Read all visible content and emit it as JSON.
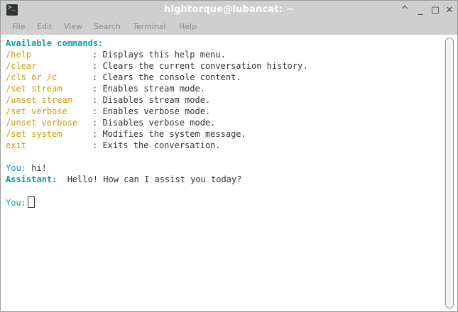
{
  "window": {
    "title": "hightorque@lubancat: ~",
    "icon": "terminal-icon",
    "controls": {
      "minimize": "_",
      "maximize": "□",
      "close": "✕",
      "shade": "^"
    }
  },
  "menu": [
    "File",
    "Edit",
    "View",
    "Search",
    "Terminal",
    "Help"
  ],
  "terminal": {
    "header": "Available commands:",
    "commands": [
      {
        "cmd": "/help",
        "desc": "Displays this help menu."
      },
      {
        "cmd": "/clear",
        "desc": "Clears the current conversation history."
      },
      {
        "cmd": "/cls or /c",
        "desc": "Clears the console content."
      },
      {
        "cmd": "/set stream",
        "desc": "Enables stream mode."
      },
      {
        "cmd": "/unset stream",
        "desc": "Disables stream mode."
      },
      {
        "cmd": "/set verbose",
        "desc": "Enables verbose mode."
      },
      {
        "cmd": "/unset verbose",
        "desc": "Disables verbose mode."
      },
      {
        "cmd": "/set system",
        "desc": "Modifies the system message."
      },
      {
        "cmd": "exit",
        "desc": "Exits the conversation."
      }
    ],
    "separator": ": ",
    "conversation": [
      {
        "speaker": "You:",
        "text": "hi!"
      },
      {
        "speaker": "Assistant:",
        "text": "Hello! How can I assist you today?"
      }
    ],
    "prompt": "You:"
  },
  "colors": {
    "prompt": "#0a9db2",
    "command": "#c4a000",
    "text": "#2e3436"
  }
}
